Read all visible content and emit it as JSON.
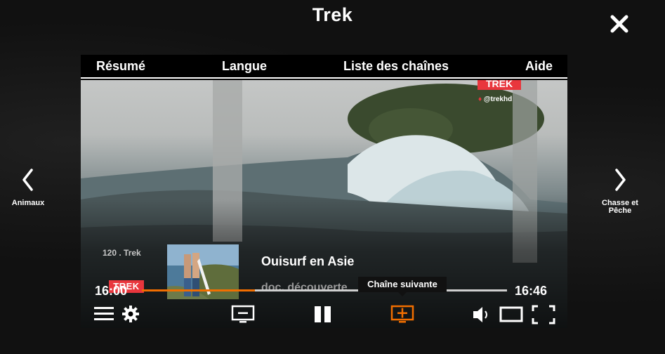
{
  "header": {
    "title": "Trek"
  },
  "nav": {
    "prev_label": "Animaux",
    "next_label": "Chasse et Pêche"
  },
  "menu": [
    "Résumé",
    "Langue",
    "Liste des chaînes",
    "Aide"
  ],
  "program": {
    "channel": "120 . Trek",
    "channel_logo": "TREK",
    "title": "Ouisurf en Asie",
    "genre": "doc. découverte",
    "start_time": "16:00",
    "end_time": "16:46",
    "progress": 0.31
  },
  "watermark": {
    "logo": "TREK",
    "handle": "@trekhd"
  },
  "tooltip": "Chaîne suivante",
  "colors": {
    "accent": "#f16e00",
    "brand_red": "#e9363d",
    "background": "#0d0d0d"
  },
  "icons": {
    "close": "close-icon",
    "prev": "chevron-left-icon",
    "next": "chevron-right-icon",
    "menu": "menu-icon",
    "settings": "gear-icon",
    "prev_channel": "channel-down-icon",
    "pause": "pause-icon",
    "next_channel": "channel-up-icon",
    "volume": "volume-icon",
    "aspect": "aspect-ratio-icon",
    "fullscreen": "fullscreen-icon"
  }
}
